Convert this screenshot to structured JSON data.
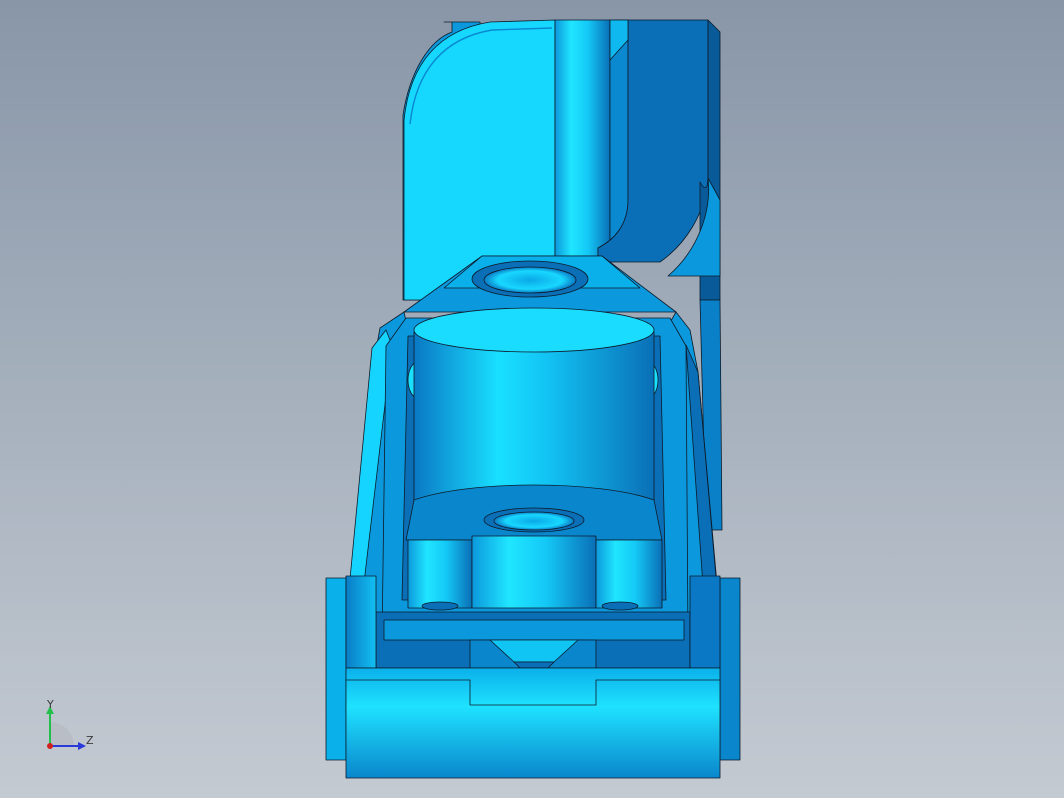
{
  "viewport": {
    "background_top": "#8896a8",
    "background_bottom": "#c4cad2"
  },
  "model": {
    "colors": {
      "light": "#19e0ff",
      "mid": "#0ab4ee",
      "base": "#0c98dc",
      "dark": "#0a6fb6",
      "darker": "#085a98",
      "edge": "#0d1b2a"
    }
  },
  "triad": {
    "y_label": "Y",
    "z_label": "Z",
    "y_color": "#22c04a",
    "z_color": "#2a3ad8",
    "x_color": "#d02020"
  }
}
